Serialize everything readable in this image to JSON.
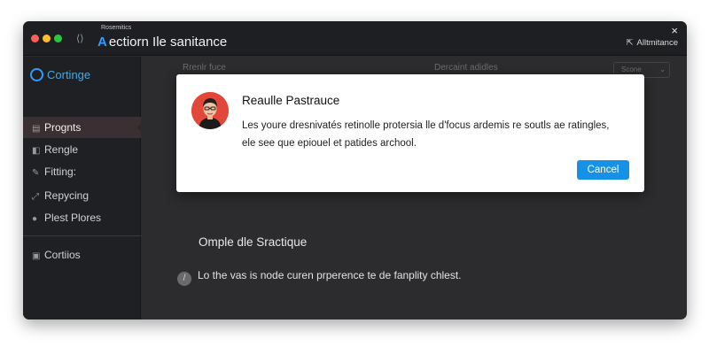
{
  "window": {
    "small_label": "Rosemitics",
    "title_accent": "A",
    "title": "ectiorn Ile sanitance",
    "toggle_glyph": "⟨⟩",
    "close_glyph": "×",
    "right_icon": "⇱",
    "right_label": "Alltmitance"
  },
  "sidebar": {
    "brand": "Cortinge",
    "items": [
      {
        "icon": "▤",
        "label": "Prognts"
      },
      {
        "icon": "◧",
        "label": "Rengle"
      },
      {
        "icon": "✎",
        "label": "Fitting:"
      },
      {
        "icon": "⤢",
        "label": "Repycing"
      },
      {
        "icon": "●",
        "label": "Plest Plores"
      },
      {
        "icon": "▣",
        "label": "Cortiios"
      }
    ]
  },
  "content": {
    "col1": "Rrenlr fuce",
    "col2": "Dercaint adidles",
    "filter": "Scone",
    "filter_chevron": "⌄",
    "section_title": "Omple dle Sractique",
    "notice_icon": "/",
    "notice_text": "Lo the vas is node curen prperence te de fanplity chlest."
  },
  "dialog": {
    "title": "Reaulle Pastrauce",
    "body_line1": "Les youre dresnivatés retinolle protersia lle d'focus ardemis re soutls ae ratingles,",
    "body_line2": "ele see que epiouel et patides archool.",
    "cancel": "Cancel"
  },
  "colors": {
    "accent": "#1592e6",
    "avatar_bg": "#e2483a",
    "window_bg": "#2c2c2e",
    "sidebar_bg": "#1f2023"
  }
}
